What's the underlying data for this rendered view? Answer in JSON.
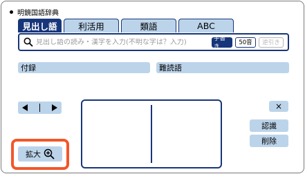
{
  "app": {
    "title": "明鏡国語辞典"
  },
  "tabs": [
    {
      "label": "見出し語",
      "active": true
    },
    {
      "label": "利活用",
      "active": false
    },
    {
      "label": "類語",
      "active": false
    },
    {
      "label": "ABC",
      "active": false
    }
  ],
  "search": {
    "placeholder": "見出し語の読み・漢字を入力(不明な字は？入力)",
    "value": "",
    "handwriting_label": "手書き",
    "gojuon_label": "50音",
    "reverse_label": "逆引き"
  },
  "links": {
    "appendix": "付録",
    "difficult_words": "難読語"
  },
  "handwriting": {
    "clear_label": "×",
    "recognize_label": "認識",
    "delete_label": "削除"
  },
  "zoom": {
    "label": "拡大"
  },
  "colors": {
    "navy": "#17357a",
    "light_blue": "#bcd4ea",
    "highlight": "#f2562a"
  }
}
